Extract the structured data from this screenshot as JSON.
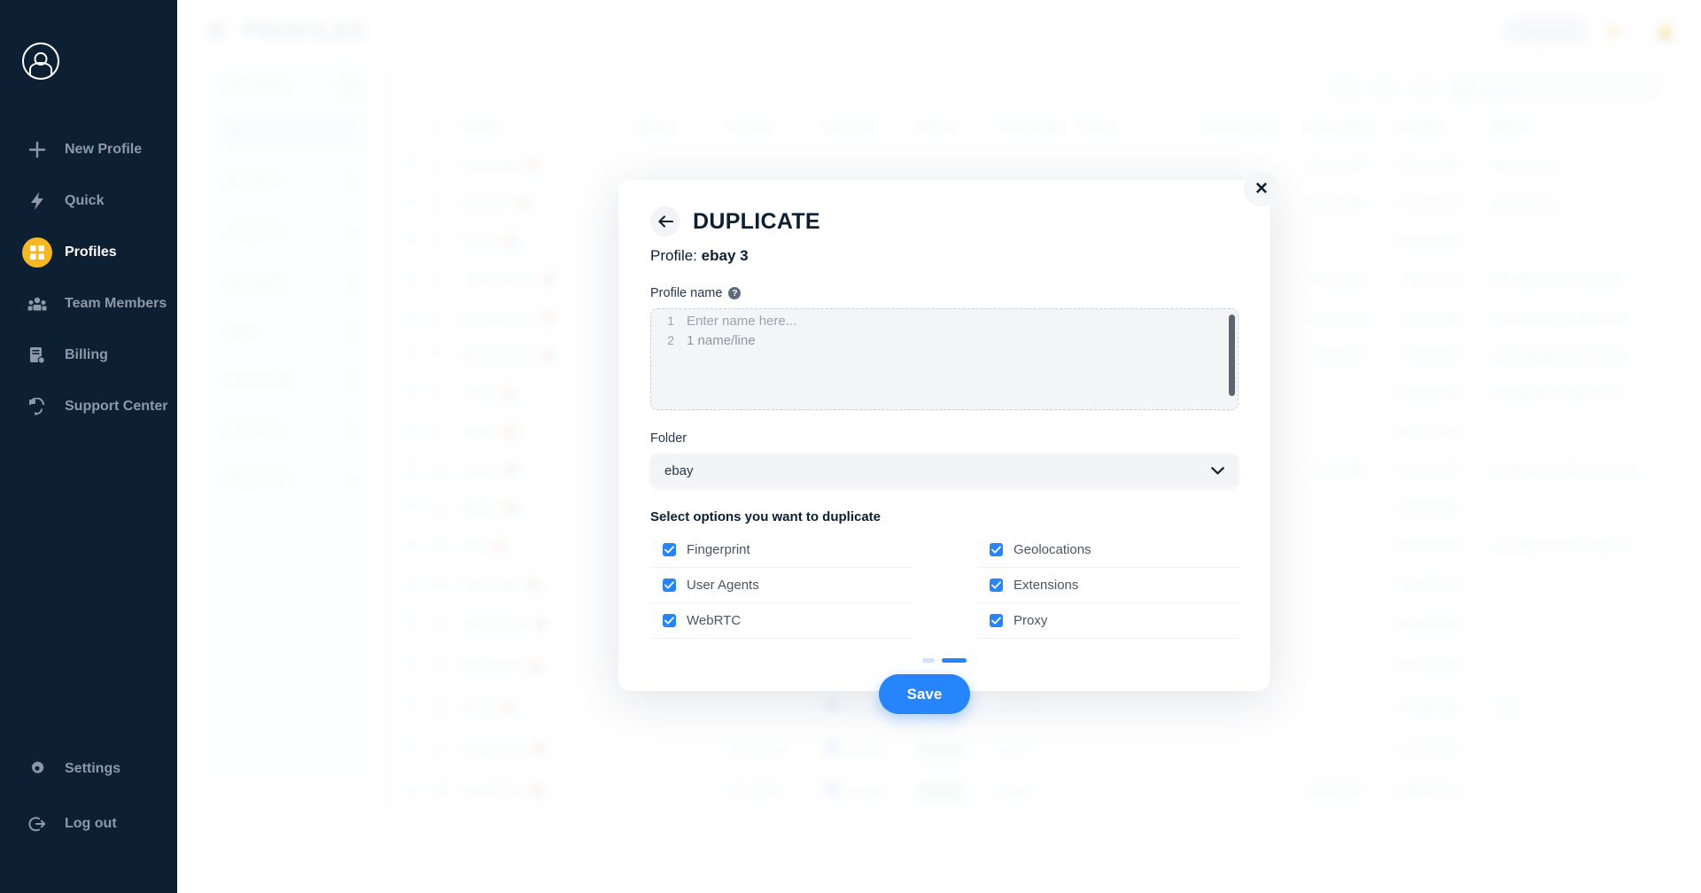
{
  "sidebar": {
    "avatar_icon": "user-avatar-icon",
    "items": [
      {
        "label": "New Profile",
        "icon": "plus-icon",
        "active": false
      },
      {
        "label": "Quick",
        "icon": "bolt-icon",
        "active": false
      },
      {
        "label": "Profiles",
        "icon": "grid-icon",
        "active": true
      },
      {
        "label": "Team Members",
        "icon": "people-icon",
        "active": false
      },
      {
        "label": "Billing",
        "icon": "invoice-icon",
        "active": false
      },
      {
        "label": "Support Center",
        "icon": "headset-icon",
        "active": false
      }
    ],
    "bottom_items": [
      {
        "label": "Settings",
        "icon": "gear-icon"
      },
      {
        "label": "Log out",
        "icon": "logout-icon"
      }
    ],
    "active_color": "#f5b722"
  },
  "background": {
    "menu_icon": "hamburger-icon",
    "page_title": "PROFILES",
    "buy_coin_label": "Buy Coin",
    "coin_count": "7",
    "bell_icon": "bell-icon",
    "folders_label": "FOLDERS",
    "add_folder_icon": "plus-icon",
    "folders": [
      {
        "name": "All",
        "count": ""
      },
      {
        "name": "Unsorted",
        "count": "1"
      },
      {
        "name": "shareEdit",
        "count": "1"
      },
      {
        "name": "shareView",
        "count": "1"
      },
      {
        "name": "eBay",
        "count": "1"
      },
      {
        "name": "Macos 123",
        "count": "1"
      },
      {
        "name": "Macos 12",
        "count": "1"
      },
      {
        "name": "Macos 122",
        "count": "1"
      }
    ],
    "toolbar_icons": [
      "globe-icon",
      "refresh-icon",
      "help-icon"
    ],
    "search_placeholder": "Search...",
    "table": {
      "columns": [
        "",
        "#",
        "Profile",
        "Folder",
        "Source",
        "Browser",
        "Status",
        "Proxy Type",
        "Proxy",
        "Last Launch",
        "Last Update",
        "Created",
        "Notes"
      ],
      "rows": [
        {
          "num": "2",
          "profile": "winEdgeee",
          "folder": "",
          "source": "",
          "browser": "",
          "status": "",
          "proxy_type": "",
          "proxy": "",
          "last_launch": "",
          "last_update": "27/04/2023",
          "created": "27/04/2023",
          "notes": "win10-win11"
        },
        {
          "num": "3",
          "profile": "winOpera",
          "folder": "",
          "source": "",
          "browser": "",
          "status": "",
          "proxy_type": "",
          "proxy": "",
          "last_launch": "",
          "last_update": "27/04/2023",
          "created": "27/04/2023",
          "notes": "gmailsocket"
        },
        {
          "num": "4",
          "profile": "nguyet",
          "folder": "",
          "source": "",
          "browser": "",
          "status": "",
          "proxy_type": "",
          "proxy": "",
          "last_launch": "",
          "last_update": "",
          "created": "04/05/2023",
          "notes": ""
        },
        {
          "num": "5",
          "profile": "win10-chrome",
          "folder": "",
          "source": "",
          "browser": "",
          "status": "",
          "proxy_type": "",
          "proxy": "",
          "last_launch": "",
          "last_update": "17/05/2023",
          "created": "17/05/2023",
          "notes": "win.nguyenngoc.bigmail"
        },
        {
          "num": "6",
          "profile": "win10-chrome",
          "folder": "",
          "source": "",
          "browser": "",
          "status": "",
          "proxy_type": "",
          "proxy": "",
          "last_launch": "",
          "last_update": "17/05/2023",
          "created": "17/05/2023",
          "notes": "dhan.nhatminh.dangmail"
        },
        {
          "num": "7",
          "profile": "win10-chrome",
          "folder": "",
          "source": "",
          "browser": "",
          "status": "",
          "proxy_type": "",
          "proxy": "",
          "last_launch": "",
          "last_update": "17/05/2023",
          "created": "17/05/2023",
          "notes": "gmailtn.lognet.in.amazon"
        },
        {
          "num": "8",
          "profile": "ebay 4",
          "folder": "",
          "source": "",
          "browser": "",
          "status": "",
          "proxy_type": "",
          "proxy": "",
          "last_launch": "",
          "last_update": "",
          "created": "09/06/2023",
          "notes": "minhquan.tieuthuyen.co"
        },
        {
          "num": "9",
          "profile": "ebay 3",
          "folder": "",
          "source": "",
          "browser": "",
          "status": "",
          "proxy_type": "",
          "proxy": "",
          "last_launch": "",
          "last_update": "",
          "created": "09/06/2023",
          "notes": ""
        },
        {
          "num": "10",
          "profile": "ebay 2",
          "folder": "",
          "source": "",
          "browser": "",
          "status": "",
          "proxy_type": "",
          "proxy": "",
          "last_launch": "",
          "last_update": "17/06/2023",
          "created": "09/06/2023",
          "notes": "quangtr.gmail@bitmail.com"
        },
        {
          "num": "11",
          "profile": "ebay 1",
          "folder": "",
          "source": "",
          "browser": "",
          "status": "",
          "proxy_type": "",
          "proxy": "",
          "last_launch": "",
          "last_update": "",
          "created": "09/06/2023",
          "notes": ""
        },
        {
          "num": "12",
          "profile": "ebay",
          "folder": "",
          "source": "",
          "browser": "",
          "status": "",
          "proxy_type": "",
          "proxy": "",
          "last_launch": "",
          "last_update": "",
          "created": "09/06/2023",
          "notes": "quangtr.tientrinh.mail.com"
        },
        {
          "num": "13",
          "profile": "Rakel Kirsti",
          "folder": "",
          "source": "",
          "browser": "",
          "status": "",
          "proxy_type": "",
          "proxy": "",
          "last_launch": "",
          "last_update": "",
          "created": "04/08/2023",
          "notes": ""
        },
        {
          "num": "14",
          "profile": "Lizzy Faythe",
          "folder": "",
          "source": "",
          "browser": "Chrome",
          "status": "Ready",
          "proxy_type": "",
          "proxy": "",
          "last_launch": "",
          "last_update": "",
          "created": "04/08/2023",
          "notes": ""
        },
        {
          "num": "15",
          "profile": "Keli Dianne",
          "folder": "",
          "source": "",
          "browser": "Chrome",
          "status": "Ready",
          "proxy_type": "FreeSE",
          "proxy": "",
          "last_launch": "",
          "last_update": "",
          "created": "04/08/2023",
          "notes": ""
        },
        {
          "num": "16",
          "profile": "freeT2",
          "folder": "",
          "source": "",
          "browser": "Chrome",
          "status": "Ready",
          "proxy_type": "FreeT2",
          "proxy": "",
          "last_launch": "",
          "last_update": "",
          "created": "04/08/2023",
          "notes": "sons"
        },
        {
          "num": "17",
          "profile": "linuxYandex",
          "folder": "",
          "source": "shareView",
          "browser": "Yandex",
          "status": "Ready",
          "proxy_type": "None",
          "proxy": "",
          "last_launch": "",
          "last_update": "",
          "created": "04/08/2023",
          "notes": ""
        },
        {
          "num": "18",
          "profile": "macYandex",
          "folder": "",
          "source": "shareEdit",
          "browser": "Yandex",
          "status": "Ready",
          "proxy_type": "None",
          "proxy": "",
          "last_launch": "",
          "last_update": "19/06/2023",
          "created": "04/08/2023",
          "notes": ""
        }
      ]
    }
  },
  "modal": {
    "back_icon": "arrow-left-icon",
    "close_icon": "close-icon",
    "title": "DUPLICATE",
    "profile_prefix": "Profile:",
    "profile_name": "ebay 3",
    "name_field_label": "Profile name",
    "help_icon": "question-mark-icon",
    "name_lines": [
      {
        "number": "1",
        "text": "Enter name here..."
      },
      {
        "number": "2",
        "text": "1 name/line"
      }
    ],
    "folder_label": "Folder",
    "folder_value": "ebay",
    "folder_chevron_icon": "chevron-down-icon",
    "options_title": "Select options you want to duplicate",
    "options_left": [
      {
        "label": "Fingerprint",
        "checked": true
      },
      {
        "label": "User Agents",
        "checked": true
      },
      {
        "label": "WebRTC",
        "checked": true
      }
    ],
    "options_right": [
      {
        "label": "Geolocations",
        "checked": true
      },
      {
        "label": "Extensions",
        "checked": true
      },
      {
        "label": "Proxy",
        "checked": true
      }
    ],
    "pagination": {
      "total": 2,
      "active_index": 1
    },
    "save_label": "Save",
    "accent_color": "#2684fc"
  }
}
